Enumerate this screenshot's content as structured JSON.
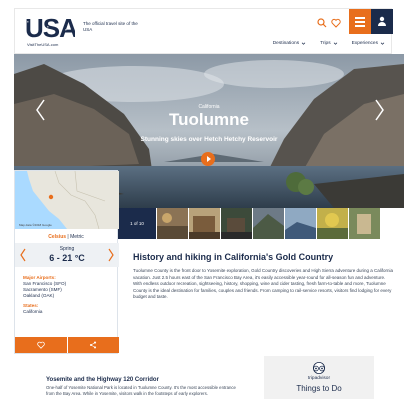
{
  "header": {
    "logo_sub": "VisitTheUSA.com",
    "tagline": "The official travel site of the USA",
    "nav": [
      {
        "label": "Destinations"
      },
      {
        "label": "Trips"
      },
      {
        "label": "Experiences"
      }
    ],
    "icons": [
      "search-icon",
      "heart-icon",
      "hamburger-menu-icon",
      "user-icon"
    ]
  },
  "hero": {
    "eyebrow": "California",
    "title": "Tuolumne",
    "caption": "Stunning skies over Hetch Hetchy Reservoir"
  },
  "gallery": {
    "counter": "1 of 10"
  },
  "side_panel": {
    "map_caption": "Map data ©2018 Google",
    "unit_celsius": "Celsius",
    "unit_separator": " | ",
    "unit_metric": "Metric",
    "season": "Spring",
    "temperature": "6 - 21 °C",
    "major_airports_label": "Major Airports:",
    "airports": [
      "San Francisco (SFO)",
      "Sacramento (SMF)",
      "Oakland (OAK)"
    ],
    "states_label": "States:",
    "state": "California"
  },
  "article": {
    "title": "History and hiking in California's Gold Country",
    "body": "Tuolumne County is the front door to Yosemite exploration, Gold Country discoveries and High Sierra adventure during a California vacation. Just 2.5 hours east of the San Francisco Bay Area, it's easily accessible year-round for all-season fun and adventure. With endless outdoor recreation, sightseeing, history, shopping, wine and cider tasting, fresh farm-to-table and more, Tuolumne County is the ideal destination for families, couples and friends. From camping to rail-service resorts, visitors find lodging for every budget and taste."
  },
  "bottom": {
    "corridor_title": "Yosemite and the Highway 120 Corridor",
    "corridor_body": "One-half of Yosemite National Park is located in Tuolumne County. It's the most accessible entrance from the Bay Area. While in Yosemite, visitors walk in the footsteps of early explorers.",
    "tripadvisor_word": "tripadvisor",
    "things_to_do": "Things to Do"
  },
  "colors": {
    "accent": "#e86e1c",
    "navy": "#1b2b4b"
  }
}
